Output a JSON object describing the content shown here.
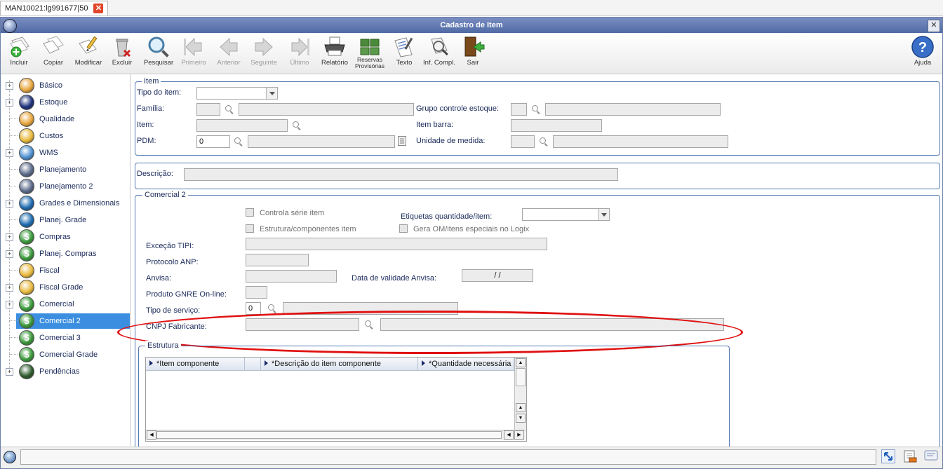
{
  "tab": {
    "label": "MAN10021:lg991677|50"
  },
  "window": {
    "title": "Cadastro de Item"
  },
  "toolbar": [
    {
      "id": "incluir",
      "label": "Incluir",
      "enabled": true
    },
    {
      "id": "copiar",
      "label": "Copiar",
      "enabled": true
    },
    {
      "id": "modificar",
      "label": "Modificar",
      "enabled": true
    },
    {
      "id": "excluir",
      "label": "Excluir",
      "enabled": true
    },
    {
      "id": "pesquisar",
      "label": "Pesquisar",
      "enabled": true
    },
    {
      "id": "primeiro",
      "label": "Primeiro",
      "enabled": false
    },
    {
      "id": "anterior",
      "label": "Anterior",
      "enabled": false
    },
    {
      "id": "seguinte",
      "label": "Seguinte",
      "enabled": false
    },
    {
      "id": "ultimo",
      "label": "Último",
      "enabled": false
    },
    {
      "id": "relatorio",
      "label": "Relatório",
      "enabled": true
    },
    {
      "id": "reservas",
      "label": "Reservas",
      "label2": "Provisórias",
      "enabled": true
    },
    {
      "id": "texto",
      "label": "Texto",
      "enabled": true
    },
    {
      "id": "infcompl",
      "label": "Inf. Compl.",
      "enabled": true
    },
    {
      "id": "sair",
      "label": "Sair",
      "enabled": true
    },
    {
      "id": "ajuda",
      "label": "Ajuda",
      "enabled": true
    }
  ],
  "tree": [
    {
      "label": "Básico",
      "expandable": true,
      "icon": "cone-icon",
      "color": "#e8a53a"
    },
    {
      "label": "Estoque",
      "expandable": true,
      "icon": "lock-icon",
      "color": "#1b2e7a"
    },
    {
      "label": "Qualidade",
      "expandable": false,
      "icon": "cone-icon",
      "color": "#e8a53a"
    },
    {
      "label": "Custos",
      "expandable": false,
      "icon": "money-icon",
      "color": "#e8b83a"
    },
    {
      "label": "WMS",
      "expandable": true,
      "icon": "wms-icon",
      "color": "#4a8fd0"
    },
    {
      "label": "Planejamento",
      "expandable": false,
      "icon": "planning-icon",
      "color": "#5a6a8a"
    },
    {
      "label": "Planejamento 2",
      "expandable": false,
      "icon": "planning-icon",
      "color": "#5a6a8a"
    },
    {
      "label": "Grades e Dimensionais",
      "expandable": true,
      "icon": "grid-icon",
      "color": "#1a6ab0"
    },
    {
      "label": "Planej. Grade",
      "expandable": false,
      "icon": "grid-icon",
      "color": "#1a6ab0"
    },
    {
      "label": "Compras",
      "expandable": true,
      "icon": "dollar-icon",
      "color": "#3a9a3a"
    },
    {
      "label": "Planej. Compras",
      "expandable": true,
      "icon": "dollar-icon",
      "color": "#3a9a3a"
    },
    {
      "label": "Fiscal",
      "expandable": false,
      "icon": "money-icon",
      "color": "#e8b83a"
    },
    {
      "label": "Fiscal Grade",
      "expandable": true,
      "icon": "money-icon",
      "color": "#e8b83a"
    },
    {
      "label": "Comercial",
      "expandable": true,
      "icon": "dollar-icon",
      "color": "#3a9a3a"
    },
    {
      "label": "Comercial 2",
      "expandable": false,
      "icon": "dollar-icon",
      "color": "#3a9a3a",
      "selected": true
    },
    {
      "label": "Comercial 3",
      "expandable": false,
      "icon": "dollar-icon",
      "color": "#3a9a3a"
    },
    {
      "label": "Comercial Grade",
      "expandable": false,
      "icon": "dollar-icon",
      "color": "#3a9a3a"
    },
    {
      "label": "Pendências",
      "expandable": true,
      "icon": "pending-icon",
      "color": "#2a5a2a"
    }
  ],
  "item_section": {
    "legend": "Item",
    "tipo_label": "Tipo do item:",
    "familia_label": "Família:",
    "item_label": "Item:",
    "pdm_label": "PDM:",
    "pdm_value": "0",
    "grupo_label": "Grupo controle estoque:",
    "item_barra_label": "Item barra:",
    "unidade_label": "Unidade de medida:"
  },
  "descricao_label": "Descrição:",
  "comercial2": {
    "legend": "Comercial 2",
    "controla_serie": "Controla série item",
    "estrutura_comp": "Estrutura/componentes item",
    "etiquetas_label": "Etiquetas quantidade/item:",
    "gera_om": "Gera OM/itens especiais no Logix",
    "excecao_label": "Exceção TIPI:",
    "protocolo_label": "Protocolo ANP:",
    "anvisa_label": "Anvisa:",
    "data_validade_label": "Data de validade Anvisa:",
    "data_validade_value": "/ /",
    "gnre_label": "Produto GNRE On-line:",
    "tipo_servico_label": "Tipo de serviço:",
    "tipo_servico_value": "0",
    "cnpj_label": "CNPJ Fabricante:"
  },
  "estrutura": {
    "legend": "Estrutura",
    "columns": [
      "*Item componente",
      "",
      "*Descrição do item componente",
      "*Quantidade necessária"
    ]
  },
  "colors": {
    "titlebar": "#5a72ad",
    "selection": "#3c8fe0",
    "annotation": "#e01010",
    "fieldset": "#557ab0"
  }
}
